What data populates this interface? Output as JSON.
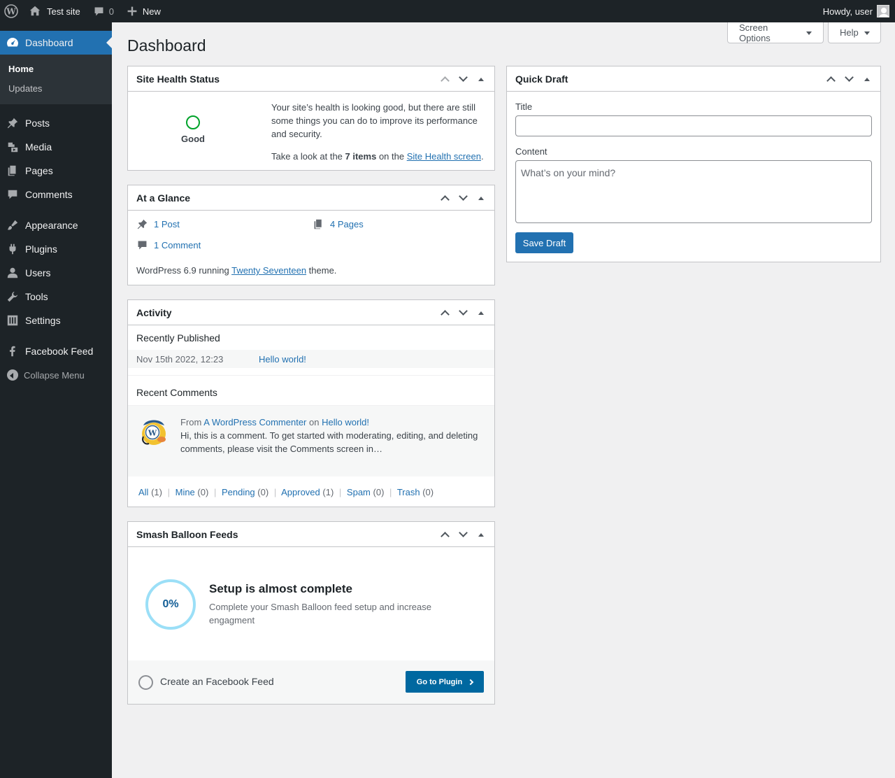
{
  "adminbar": {
    "site_name": "Test site",
    "comments_count": "0",
    "new_label": "New",
    "howdy": "Howdy, user"
  },
  "sidebar": {
    "dashboard": "Dashboard",
    "home": "Home",
    "updates": "Updates",
    "items": [
      "Posts",
      "Media",
      "Pages",
      "Comments",
      "Appearance",
      "Plugins",
      "Users",
      "Tools",
      "Settings",
      "Facebook Feed"
    ],
    "collapse": "Collapse Menu"
  },
  "main": {
    "title": "Dashboard",
    "screen_options": "Screen Options",
    "help": "Help"
  },
  "site_health": {
    "title": "Site Health Status",
    "status": "Good",
    "text1": "Your site’s health is looking good, but there are still some things you can do to improve its performance and security.",
    "text2_pre": "Take a look at the ",
    "text2_bold": "7 items",
    "text2_mid": " on the ",
    "text2_link": "Site Health screen",
    "text2_post": "."
  },
  "glance": {
    "title": "At a Glance",
    "posts": "1 Post",
    "pages": "4 Pages",
    "comments": "1 Comment",
    "footer_pre": "WordPress 6.9 running ",
    "theme": "Twenty Seventeen",
    "footer_post": " theme."
  },
  "activity": {
    "title": "Activity",
    "recently_published": "Recently Published",
    "pub_date": "Nov 15th 2022, 12:23",
    "pub_title": "Hello world!",
    "recent_comments": "Recent Comments",
    "from": "From",
    "commenter": "A WordPress Commenter",
    "on": "on",
    "comment_post": "Hello world!",
    "comment_text": "Hi, this is a comment. To get started with moderating, editing, and deleting comments, please visit the Comments screen in…",
    "filters": [
      {
        "label": "All",
        "count": "(1)"
      },
      {
        "label": "Mine",
        "count": "(0)"
      },
      {
        "label": "Pending",
        "count": "(0)"
      },
      {
        "label": "Approved",
        "count": "(1)"
      },
      {
        "label": "Spam",
        "count": "(0)"
      },
      {
        "label": "Trash",
        "count": "(0)"
      }
    ]
  },
  "smash": {
    "title": "Smash Balloon Feeds",
    "percent": "0%",
    "heading": "Setup is almost complete",
    "desc": "Complete your Smash Balloon feed setup and increase engagment",
    "task": "Create an Facebook Feed",
    "button": "Go to Plugin"
  },
  "quick_draft": {
    "title": "Quick Draft",
    "title_label": "Title",
    "content_label": "Content",
    "content_placeholder": "What’s on your mind?",
    "save": "Save Draft"
  }
}
